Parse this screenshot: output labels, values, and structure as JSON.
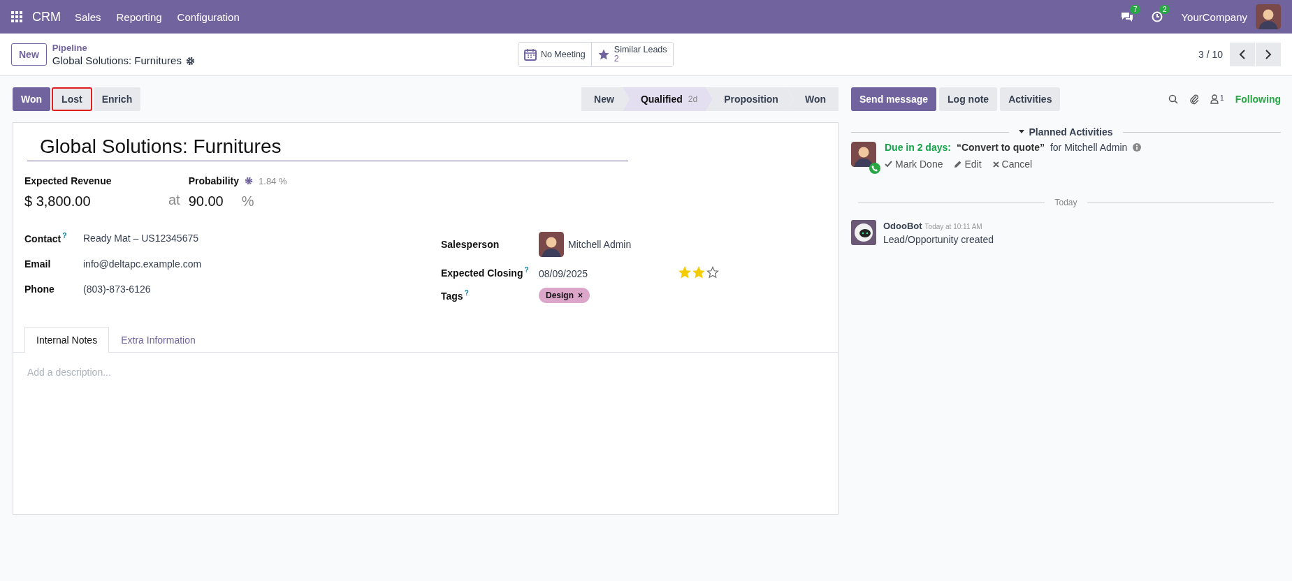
{
  "navbar": {
    "app": "CRM",
    "menu": [
      "Sales",
      "Reporting",
      "Configuration"
    ],
    "messages_count": "7",
    "activities_count": "2",
    "company": "YourCompany"
  },
  "control_panel": {
    "new_button": "New",
    "breadcrumb": "Pipeline",
    "record_title": "Global Solutions: Furnitures",
    "smart_buttons": [
      {
        "kind": "calendar",
        "label": "No Meeting"
      },
      {
        "kind": "star",
        "label": "Similar Leads",
        "value": "2"
      }
    ],
    "pager": "3 / 10"
  },
  "actions": [
    {
      "label": "Won",
      "primary": true,
      "highlighted": false
    },
    {
      "label": "Lost",
      "primary": false,
      "highlighted": true
    },
    {
      "label": "Enrich",
      "primary": false,
      "highlighted": false
    }
  ],
  "stages": [
    {
      "label": "New",
      "selected": false
    },
    {
      "label": "Qualified",
      "selected": true,
      "duration": "2d"
    },
    {
      "label": "Proposition",
      "selected": false
    },
    {
      "label": "Won",
      "selected": false
    }
  ],
  "form": {
    "name": "Global Solutions: Furnitures",
    "revenue_label": "Expected Revenue",
    "revenue": "$ 3,800.00",
    "at": "at",
    "probability_label": "Probability",
    "auto_probability": "1.84 %",
    "probability": "90.00",
    "percent": "%",
    "left_fields": [
      {
        "label": "Contact",
        "help": "?",
        "value": "Ready Mat – US12345675"
      },
      {
        "label": "Email",
        "value": "info@deltapc.example.com"
      },
      {
        "label": "Phone",
        "value": "(803)-873-6126"
      }
    ],
    "salesperson_label": "Salesperson",
    "salesperson": "Mitchell Admin",
    "closing_label": "Expected Closing",
    "closing_help": "?",
    "tags_help": "?",
    "closing": "08/09/2025",
    "stars": 2,
    "tags_label": "Tags",
    "tags": [
      {
        "label": "Design",
        "color": "#dca6cb",
        "remove": "×"
      }
    ],
    "tabs": [
      {
        "label": "Internal Notes",
        "selected": true
      },
      {
        "label": "Extra Information",
        "selected": false
      }
    ],
    "description_placeholder": "Add a description..."
  },
  "chatter": {
    "buttons": [
      {
        "label": "Send message",
        "primary": true
      },
      {
        "label": "Log note",
        "primary": false
      },
      {
        "label": "Activities",
        "primary": false
      }
    ],
    "followers_count": "1",
    "following": "Following",
    "planned_title": "Planned Activities",
    "activity": {
      "due": "Due in 2 days:",
      "summary": "“Convert to quote”",
      "assignee": "for Mitchell Admin",
      "mark_done": "Mark Done",
      "edit": "Edit",
      "cancel": "Cancel"
    },
    "date_separator": "Today",
    "messages": [
      {
        "author": "OdooBot",
        "time": "Today at 10:11 AM",
        "body": "Lead/Opportunity created"
      }
    ]
  }
}
